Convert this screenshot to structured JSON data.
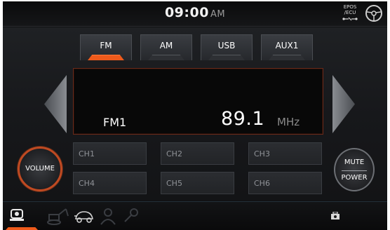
{
  "status": {
    "time": "09:00",
    "ampm": "AM",
    "epos_line1": "EPOS",
    "epos_line2": "/ECU"
  },
  "tabs": [
    {
      "label": "FM",
      "active": true
    },
    {
      "label": "AM",
      "active": false
    },
    {
      "label": "USB",
      "active": false
    },
    {
      "label": "AUX1",
      "active": false
    }
  ],
  "display": {
    "band": "FM1",
    "frequency": "89.1",
    "unit": "MHz"
  },
  "buttons": {
    "volume": "VOLUME",
    "mute": "MUTE",
    "power": "POWER"
  },
  "presets": [
    "CH1",
    "CH2",
    "CH3",
    "CH4",
    "CH5",
    "CH6"
  ],
  "colors": {
    "accent": "#ee5a1b",
    "background": "#0f1012",
    "display_border": "#6a2a1a"
  },
  "icons": {
    "epos": "plug-icon",
    "steering": "steering-wheel-icon",
    "bottom_active": "machine-settings-icon",
    "bottom_items": [
      "excavator-icon",
      "engine-icon",
      "operator-icon",
      "wrench-icon"
    ],
    "bottom_right": "speaker-icon"
  }
}
